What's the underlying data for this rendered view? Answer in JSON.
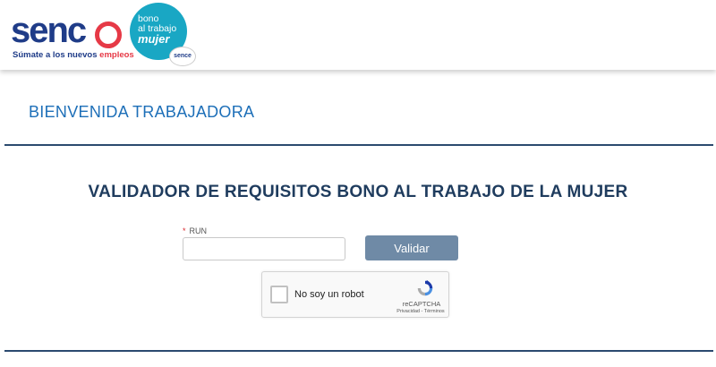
{
  "header": {
    "logo_word": "senc",
    "logo_tagline_prefix": "Súmate a los nuevos ",
    "logo_tagline_highlight": "empleos",
    "badge_line1": "bono",
    "badge_line2": "al trabajo",
    "badge_line3": "mujer",
    "badge_mini": "sence"
  },
  "welcome": "BIENVENIDA TRABAJADORA",
  "form": {
    "title": "VALIDADOR DE REQUISITOS BONO AL TRABAJO DE LA MUJER",
    "run_required_mark": "*",
    "run_label": "RUN",
    "run_value": "",
    "submit_label": "Validar"
  },
  "captcha": {
    "label": "No soy un robot",
    "brand": "reCAPTCHA",
    "links": "Privacidad - Términos"
  },
  "colors": {
    "brand_blue": "#1f3c88",
    "brand_red": "#e63946",
    "badge_teal": "#19a7c4",
    "welcome_blue": "#1d6fb8",
    "rule_navy": "#2b4a6f",
    "button_gray_blue": "#6f8aa6"
  }
}
